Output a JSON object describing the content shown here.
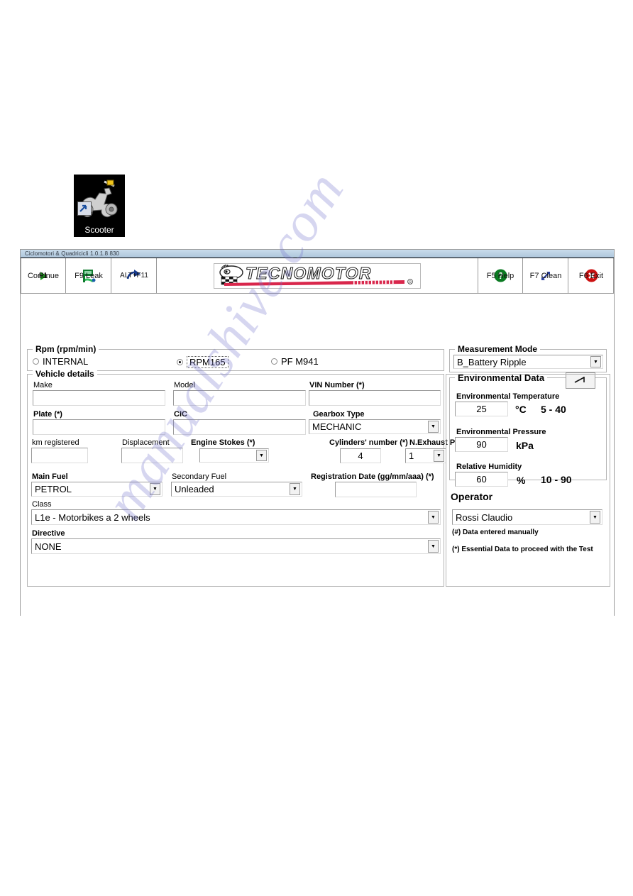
{
  "desktop": {
    "icon_label": "Scooter",
    "icon_name": "scooter-shortcut-icon"
  },
  "window": {
    "title": "Ciclomotori & Quadricicli 1.0.1.8  830",
    "logo_text": "TECNOMOTOR",
    "logo_reg": "®"
  },
  "toolbar": {
    "buttons": [
      {
        "key": "continue",
        "line1": "F1",
        "line2": "Continue",
        "icon": "play-triangle-icon"
      },
      {
        "key": "leak",
        "line1": "F9 Leak",
        "line2": "",
        "icon": "leak-test-icon"
      },
      {
        "key": "alt_f11",
        "line1": "ALT+F11",
        "line2": "",
        "icon": "curved-arrow-icon"
      },
      {
        "key": "help",
        "line1": "F5 Help",
        "line2": "",
        "icon": "question-mark-icon"
      },
      {
        "key": "clean",
        "line1": "F7 Clean",
        "line2": "",
        "icon": "diagonal-arrows-icon"
      },
      {
        "key": "exit",
        "line1": "F6 Exit",
        "line2": "",
        "icon": "close-x-icon"
      }
    ]
  },
  "rpm_group": {
    "title": "Rpm (rpm/min)",
    "options": [
      {
        "label": "INTERNAL",
        "selected": false
      },
      {
        "label": "RPM165",
        "selected": true
      },
      {
        "label": "PF M941",
        "selected": false
      }
    ]
  },
  "measurement_mode": {
    "title": "Measurement Mode",
    "value": "B_Battery Ripple"
  },
  "vehicle": {
    "title": "Vehicle details",
    "make_label": "Make",
    "make_value": "",
    "model_label": "Model",
    "model_value": "",
    "vin_label": "VIN Number (*)",
    "vin_value": "",
    "plate_label": "Plate (*)",
    "plate_value": "",
    "cic_label": "CIC",
    "cic_value": "",
    "gearbox_label": "Gearbox Type",
    "gearbox_value": "MECHANIC",
    "km_label": "km registered",
    "km_value": "",
    "displacement_label": "Displacement",
    "displacement_value": "",
    "engine_stokes_label": "Engine Stokes (*)",
    "engine_stokes_value": "",
    "cylinders_label": "Cylinders' number (*)",
    "cylinders_value": "4",
    "exhaust_label": "N.Exhaust Pipes",
    "exhaust_value": "1",
    "main_fuel_label": "Main Fuel",
    "main_fuel_value": "PETROL",
    "secondary_fuel_label": "Secondary Fuel",
    "secondary_fuel_value": "Unleaded",
    "registration_label": "Registration Date (gg/mm/aaa) (*)",
    "registration_value": "",
    "class_label": "Class",
    "class_value": "L1e - Motorbikes a 2 wheels",
    "directive_label": "Directive",
    "directive_value": "NONE"
  },
  "environment": {
    "title": "Environmental Data",
    "edit_icon": "pencil-edit-icon",
    "temperature_label": "Environmental Temperature",
    "temperature_value": "25",
    "temperature_unit": "°C",
    "temperature_range": "5 - 40",
    "pressure_label": "Environmental Pressure",
    "pressure_value": "90",
    "pressure_unit": "kPa",
    "humidity_label": "Relative Humidity",
    "humidity_value": "60",
    "humidity_unit": "%",
    "humidity_range": "10 - 90"
  },
  "operator": {
    "title": "Operator",
    "value": "Rossi Claudio"
  },
  "notes": {
    "manual": "(#) Data entered manually",
    "essential": "(*) Essential Data to proceed with the Test"
  },
  "watermark": {
    "text": "manualshive.com"
  }
}
